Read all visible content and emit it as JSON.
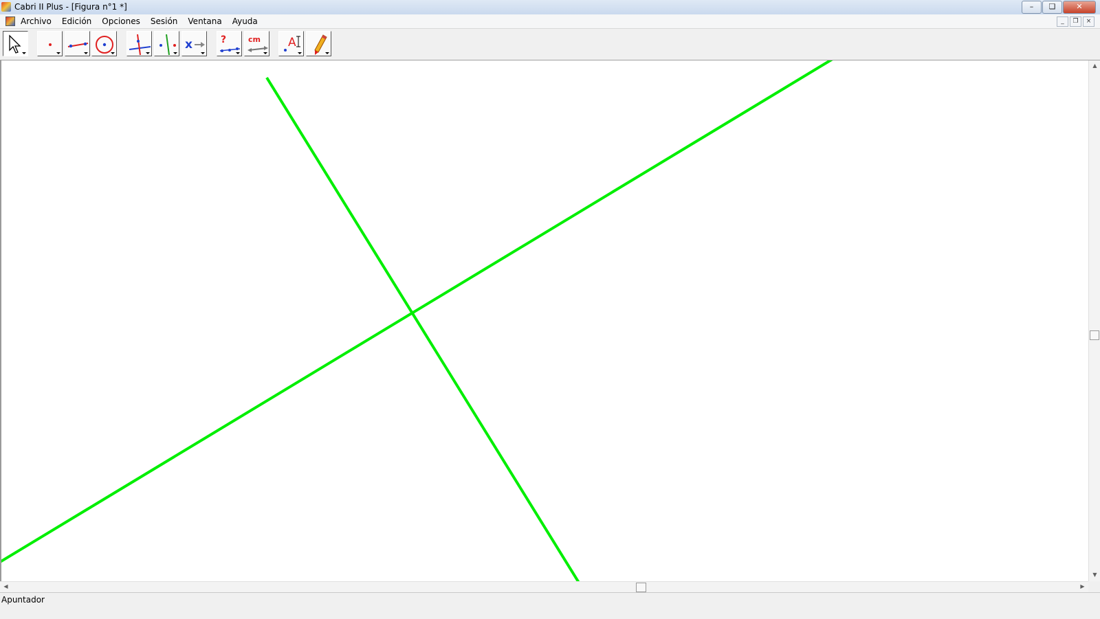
{
  "window": {
    "title": "Cabri II Plus - [Figura n°1 *]",
    "minimize_label": "–",
    "restore_label": "❏",
    "close_label": "✕"
  },
  "menu": {
    "items": [
      "Archivo",
      "Edición",
      "Opciones",
      "Sesión",
      "Ventana",
      "Ayuda"
    ],
    "mdi_minimize": "_",
    "mdi_restore": "❐",
    "mdi_close": "×"
  },
  "toolbar": {
    "tools": [
      {
        "name": "pointer-tool",
        "icon": "pointer-arrow-icon",
        "active": true
      },
      {
        "name": "point-tool",
        "icon": "point-icon"
      },
      {
        "name": "line-tool",
        "icon": "line-icon"
      },
      {
        "name": "circle-tool",
        "icon": "circle-icon"
      },
      {
        "name": "perpendicular-tool",
        "icon": "perpendicular-line-icon"
      },
      {
        "name": "symmetry-tool",
        "icon": "reflection-icon"
      },
      {
        "name": "macro-tool",
        "icon": "macro-icon",
        "label": "x"
      },
      {
        "name": "check-property-tool",
        "icon": "collinear-check-icon",
        "label": "?"
      },
      {
        "name": "measure-tool",
        "icon": "distance-measure-icon",
        "label": "cm"
      },
      {
        "name": "display-tool",
        "icon": "label-text-icon",
        "label": "A"
      },
      {
        "name": "drawing-tool",
        "icon": "pencil-icon"
      }
    ]
  },
  "canvas": {
    "line_color": "#00ee00"
  },
  "scrollbars": {
    "up": "▲",
    "down": "▼",
    "left": "◀",
    "right": "▶"
  },
  "status": {
    "text": "Apuntador"
  }
}
